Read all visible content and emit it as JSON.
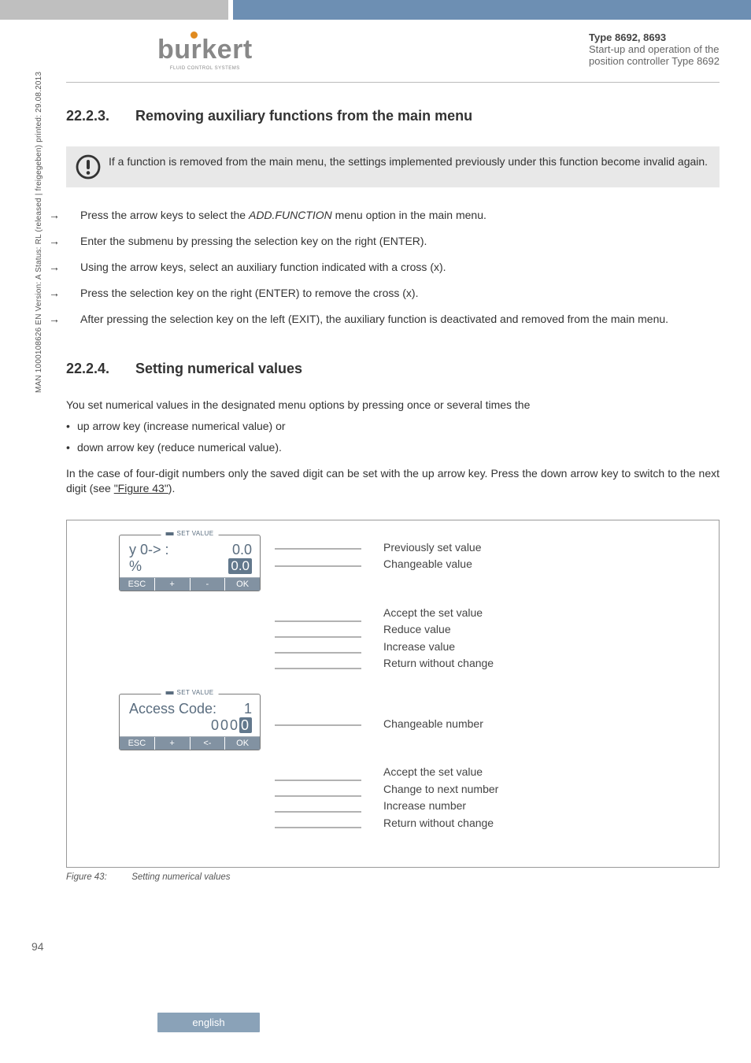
{
  "header": {
    "logo_word": "burkert",
    "logo_tag": "FLUID CONTROL SYSTEMS",
    "type_line": "Type 8692, 8693",
    "meta_line1": "Start-up and operation of the",
    "meta_line2": "position controller Type 8692"
  },
  "vertical_meta": "MAN 1000108626 EN Version: A Status: RL (released | freigegeben) printed: 29.08.2013",
  "section_2223": {
    "num": "22.2.3.",
    "title": "Removing auxiliary functions from the main menu",
    "callout": "If a function is removed from the main menu, the settings implemented previously under this function become invalid again.",
    "steps": {
      "s1a": "Press the arrow keys to select the ",
      "s1b": "ADD.FUNCTION",
      "s1c": " menu option in the main menu.",
      "s2": "Enter the submenu by pressing the selection key on the right (ENTER).",
      "s3": "Using the arrow keys, select an auxiliary function indicated with a cross (x).",
      "s4": "Press the selection key on the right (ENTER) to remove the cross (x).",
      "s5": "After pressing the selection key on the left (EXIT), the auxiliary function is deactivated and removed from the main menu."
    }
  },
  "section_2224": {
    "num": "22.2.4.",
    "title": "Setting numerical values",
    "intro": "You set numerical values in the designated menu options by pressing once or several times the",
    "b1": "up arrow key (increase numerical value) or",
    "b2": "down arrow key (reduce numerical value).",
    "para2a": "In the case of four-digit numbers only the saved digit can be set with the up arrow key. Press the down arrow key to switch to the next digit (see ",
    "para2b": "\"Figure 43\"",
    "para2c": ")."
  },
  "fig": {
    "panel1": {
      "lcd_title": "SET VALUE",
      "row1_left": "y 0->  :",
      "row1_right": "0.0",
      "row2_left": "%",
      "row2_right": "0.0",
      "k1": "ESC",
      "k2": "+",
      "k3": "-",
      "k4": "OK",
      "lbl_prev": "Previously set value",
      "lbl_change": "Changeable value",
      "lbl_ok": "Accept the set value",
      "lbl_minus": "Reduce value",
      "lbl_plus": "Increase value",
      "lbl_esc": "Return without change"
    },
    "panel2": {
      "lcd_title": "SET VALUE",
      "row1_left": "Access Code:",
      "row1_right": "1",
      "code_prefix": "000",
      "code_hl": "0",
      "k1": "ESC",
      "k2": "+",
      "k3": "<-",
      "k4": "OK",
      "lbl_change": "Changeable number",
      "lbl_ok": "Accept the set value",
      "lbl_next": "Change to next number",
      "lbl_plus": "Increase number",
      "lbl_esc": "Return without change"
    },
    "caption_lbl": "Figure 43:",
    "caption_txt": "Setting numerical values"
  },
  "page_num": "94",
  "footer": "english"
}
